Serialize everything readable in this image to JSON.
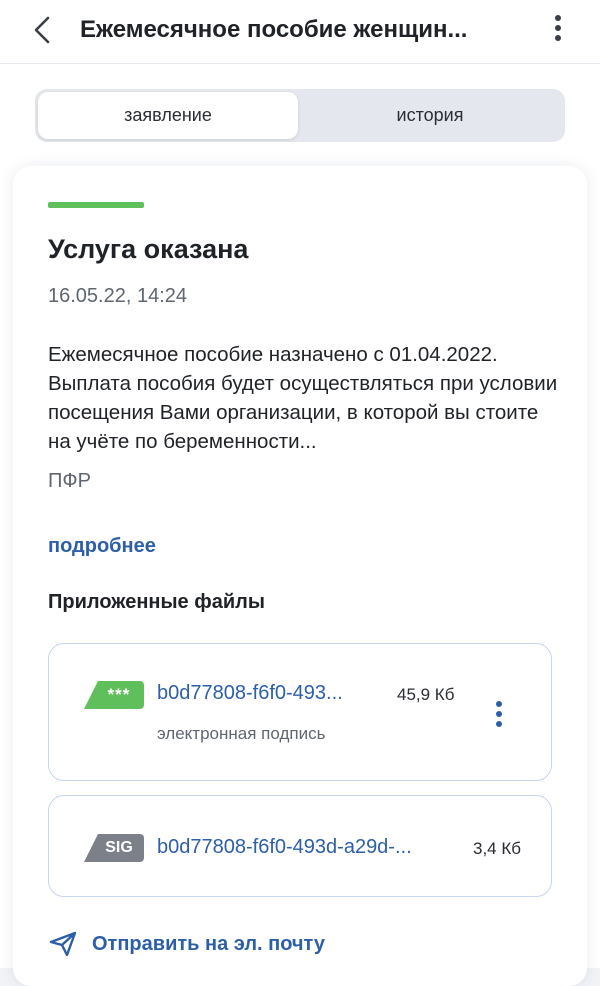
{
  "header": {
    "title": "Ежемесячное пособие женщин..."
  },
  "tabs": [
    {
      "label": "заявление",
      "active": true
    },
    {
      "label": "история",
      "active": false
    }
  ],
  "status": {
    "title": "Услуга оказана",
    "date": "16.05.22, 14:24",
    "color": "#5fbf5a",
    "description": "Ежемесячное пособие назначено с 01.04.2022. Выплата пособия будет осуществляться при условии посещения Вами организации, в которой вы стоите на учёте по беременности...",
    "org": "ПФР",
    "more_label": "подробнее"
  },
  "files": {
    "title": "Приложенные файлы",
    "items": [
      {
        "badge": "***",
        "badge_color": "#5fbf5a",
        "name": "b0d77808-f6f0-493...",
        "size": "45,9 Кб",
        "subtitle": "электронная подпись",
        "icon": "signature-badge-icon"
      },
      {
        "badge": "SIG",
        "badge_color": "#7c8089",
        "name": "b0d77808-f6f0-493d-a29d-...",
        "size": "3,4 Кб",
        "icon": "sig-file-icon"
      }
    ]
  },
  "send_email": {
    "label": "Отправить на эл. почту",
    "icon": "send-icon"
  },
  "colors": {
    "accent_blue": "#2d5fa8",
    "success_green": "#5fbf5a",
    "border": "#c6d6ec"
  }
}
